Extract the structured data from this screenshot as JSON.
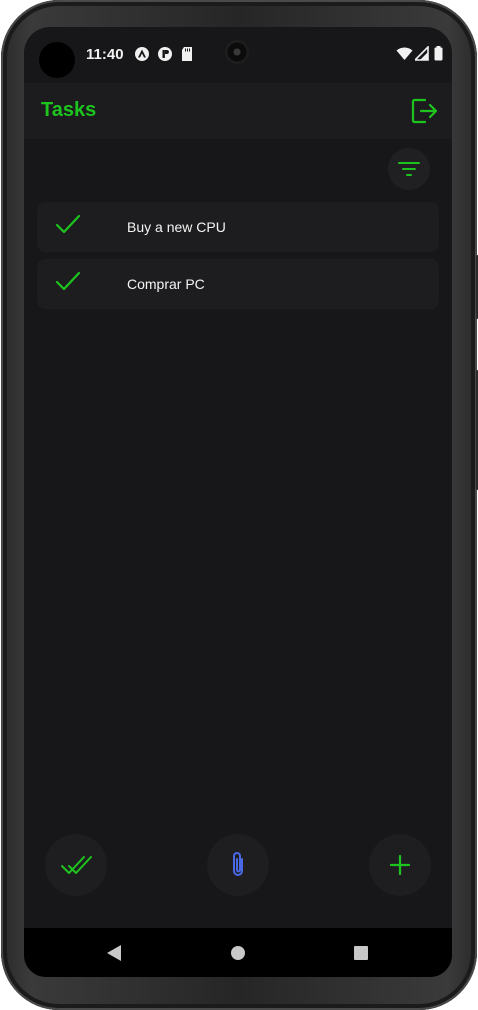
{
  "status_bar": {
    "time": "11:40",
    "left_icons": [
      "vpn-icon",
      "app-notification-icon",
      "sd-card-icon"
    ],
    "right_icons": [
      "wifi-icon",
      "signal-icon",
      "battery-icon"
    ]
  },
  "app_bar": {
    "title": "Tasks",
    "action_icon": "logout-icon"
  },
  "toolbar": {
    "filter_icon": "filter-icon"
  },
  "tasks": [
    {
      "label": "Buy a new CPU",
      "completed": true
    },
    {
      "label": "Comprar PC",
      "completed": true
    }
  ],
  "bottom_actions": [
    {
      "icon": "done-all-icon"
    },
    {
      "icon": "paperclip-icon"
    },
    {
      "icon": "add-icon"
    }
  ],
  "navigation": [
    "back",
    "home",
    "recents"
  ],
  "colors": {
    "accent": "#1ec41e",
    "attach_accent": "#4a68e6",
    "background": "#171719",
    "surface": "#1d1d1f",
    "text": "#f4f4f4"
  }
}
